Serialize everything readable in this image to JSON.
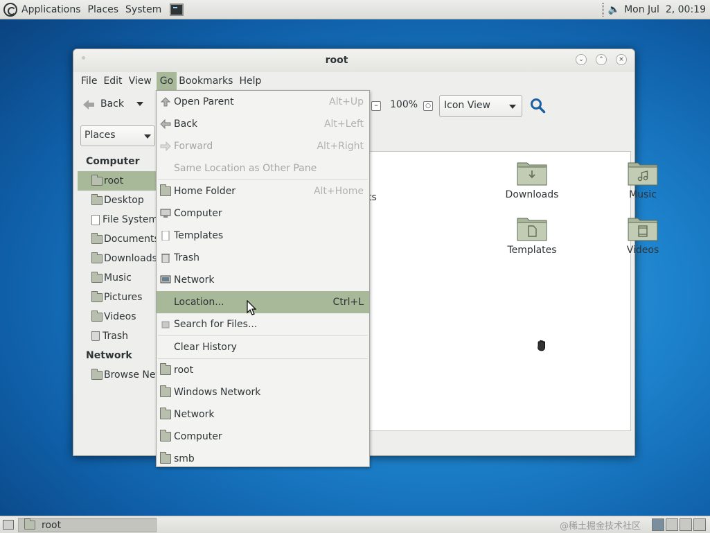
{
  "top_panel": {
    "menus": [
      "Applications",
      "Places",
      "System"
    ],
    "clock": "Mon Jul  2, 00:19"
  },
  "window": {
    "title": "root",
    "menubar": [
      "File",
      "Edit",
      "View",
      "Go",
      "Bookmarks",
      "Help"
    ],
    "toolbar": {
      "back_label": "Back",
      "zoom_level": "100%",
      "view_mode": "Icon View"
    },
    "places_select": "Places",
    "sidebar": {
      "computer_heading": "Computer",
      "computer_items": [
        {
          "label": "root",
          "icon": "home-folder-icon"
        },
        {
          "label": "Desktop",
          "icon": "folder-icon"
        },
        {
          "label": "File System",
          "icon": "file-icon"
        },
        {
          "label": "Documents",
          "icon": "folder-icon"
        },
        {
          "label": "Downloads",
          "icon": "folder-icon"
        },
        {
          "label": "Music",
          "icon": "folder-icon"
        },
        {
          "label": "Pictures",
          "icon": "folder-icon"
        },
        {
          "label": "Videos",
          "icon": "folder-icon"
        },
        {
          "label": "Trash",
          "icon": "trash-icon"
        }
      ],
      "network_heading": "Network",
      "network_items": [
        {
          "label": "Browse Network",
          "icon": "network-icon"
        }
      ]
    },
    "content": {
      "partial_label": "ts",
      "items": [
        {
          "label": "Downloads",
          "icon": "downloads-folder-icon"
        },
        {
          "label": "Music",
          "icon": "music-folder-icon"
        },
        {
          "label": "Templates",
          "icon": "templates-folder-icon"
        },
        {
          "label": "Videos",
          "icon": "videos-folder-icon"
        }
      ]
    }
  },
  "go_menu": {
    "items": [
      {
        "label": "Open Parent",
        "accel": "Alt+Up"
      },
      {
        "label": "Back",
        "accel": "Alt+Left"
      },
      {
        "label": "Forward",
        "accel": "Alt+Right"
      },
      {
        "label": "Same Location as Other Pane",
        "accel": ""
      },
      {
        "label": "Home Folder",
        "accel": "Alt+Home"
      },
      {
        "label": "Computer",
        "accel": ""
      },
      {
        "label": "Templates",
        "accel": ""
      },
      {
        "label": "Trash",
        "accel": ""
      },
      {
        "label": "Network",
        "accel": ""
      },
      {
        "label": "Location...",
        "accel": "Ctrl+L"
      },
      {
        "label": "Search for Files...",
        "accel": ""
      },
      {
        "label": "Clear History",
        "accel": ""
      },
      {
        "label": "root",
        "accel": ""
      },
      {
        "label": "Windows Network",
        "accel": ""
      },
      {
        "label": "Network",
        "accel": ""
      },
      {
        "label": "Computer",
        "accel": ""
      },
      {
        "label": "smb",
        "accel": ""
      }
    ]
  },
  "bottom_panel": {
    "task_label": "root",
    "watermark": "@稀土掘金技术社区"
  }
}
